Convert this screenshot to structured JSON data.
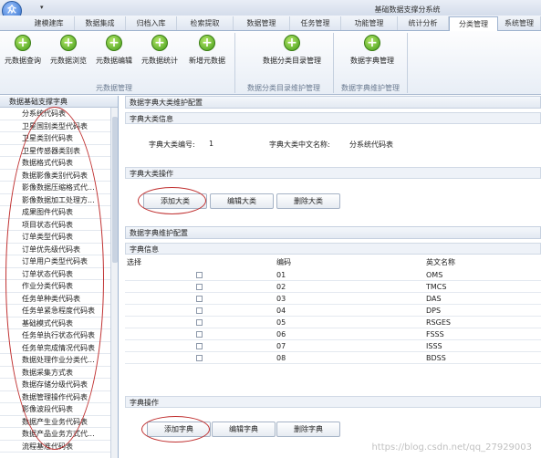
{
  "window": {
    "title": "基础数据支撑分系统",
    "app_logo_text": "众",
    "quick_access": "▾"
  },
  "menu_tabs": [
    "建模建库",
    "数据集成",
    "归档入库",
    "检索提取",
    "数据管理",
    "任务管理",
    "功能管理",
    "统计分析",
    "分类管理",
    "系统管理"
  ],
  "active_tab": "分类管理",
  "ribbon": {
    "buttons": [
      {
        "label": "元数据查询"
      },
      {
        "label": "元数据浏览"
      },
      {
        "label": "元数据编辑"
      },
      {
        "label": "元数据统计"
      },
      {
        "label": "新增元数据"
      },
      {
        "label": "数据分类目录管理"
      },
      {
        "label": "数据字典管理"
      }
    ],
    "groups": [
      "元数据管理",
      "数据分类目录维护管理",
      "数据字典维护管理"
    ]
  },
  "left_panel": {
    "header": "数据基础支撑字典",
    "items": [
      "分系统代码表",
      "卫星国别类型代码表",
      "卫星类别代码表",
      "卫星传感器类别表",
      "数据格式代码表",
      "数据影像类别代码表",
      "影像数据压缩格式代...",
      "影像数据加工处理方...",
      "成果图件代码表",
      "项目状态代码表",
      "订单类型代码表",
      "订单优先级代码表",
      "订单用户类型代码表",
      "订单状态代码表",
      "作业分类代码表",
      "任务单种类代码表",
      "任务单紧急程度代码表",
      "基础模式代码表",
      "任务单执行状态代码表",
      "任务单完成情况代码表",
      "数据处理作业分类代...",
      "数据采集方式表",
      "数据存储分级代码表",
      "数据管理操作代码表",
      "影像波段代码表",
      "数据产生业务代码表",
      "数据产品业务方式代...",
      "流程基准代码表"
    ]
  },
  "dict_category": {
    "section_title": "数据字典大类维护配置",
    "info_title": "字典大类信息",
    "code_label": "字典大类编号:",
    "code_value": "1",
    "name_label": "字典大类中文名称:",
    "name_value": "分系统代码表",
    "ops_title": "字典大类操作",
    "add_label": "添加大类",
    "edit_label": "编辑大类",
    "delete_label": "删除大类"
  },
  "dict_items": {
    "section_title": "数据字典维护配置",
    "info_title": "字典信息",
    "columns": [
      "选择",
      "编码",
      "英文名称"
    ],
    "rows": [
      {
        "code": "01",
        "name": "OMS"
      },
      {
        "code": "02",
        "name": "TMCS"
      },
      {
        "code": "03",
        "name": "DAS"
      },
      {
        "code": "04",
        "name": "DPS"
      },
      {
        "code": "05",
        "name": "RSGES"
      },
      {
        "code": "06",
        "name": "FSSS"
      },
      {
        "code": "07",
        "name": "ISSS"
      },
      {
        "code": "08",
        "name": "BDSS"
      }
    ],
    "ops_title": "字典操作",
    "add_label": "添加字典",
    "edit_label": "编辑字典",
    "delete_label": "删除字典"
  },
  "watermark": "https://blog.csdn.net/qq_27929003",
  "colors": {
    "accent_green": "#3f9a16",
    "annotation_red": "#c03030",
    "border_blue": "#9fb3cf"
  }
}
